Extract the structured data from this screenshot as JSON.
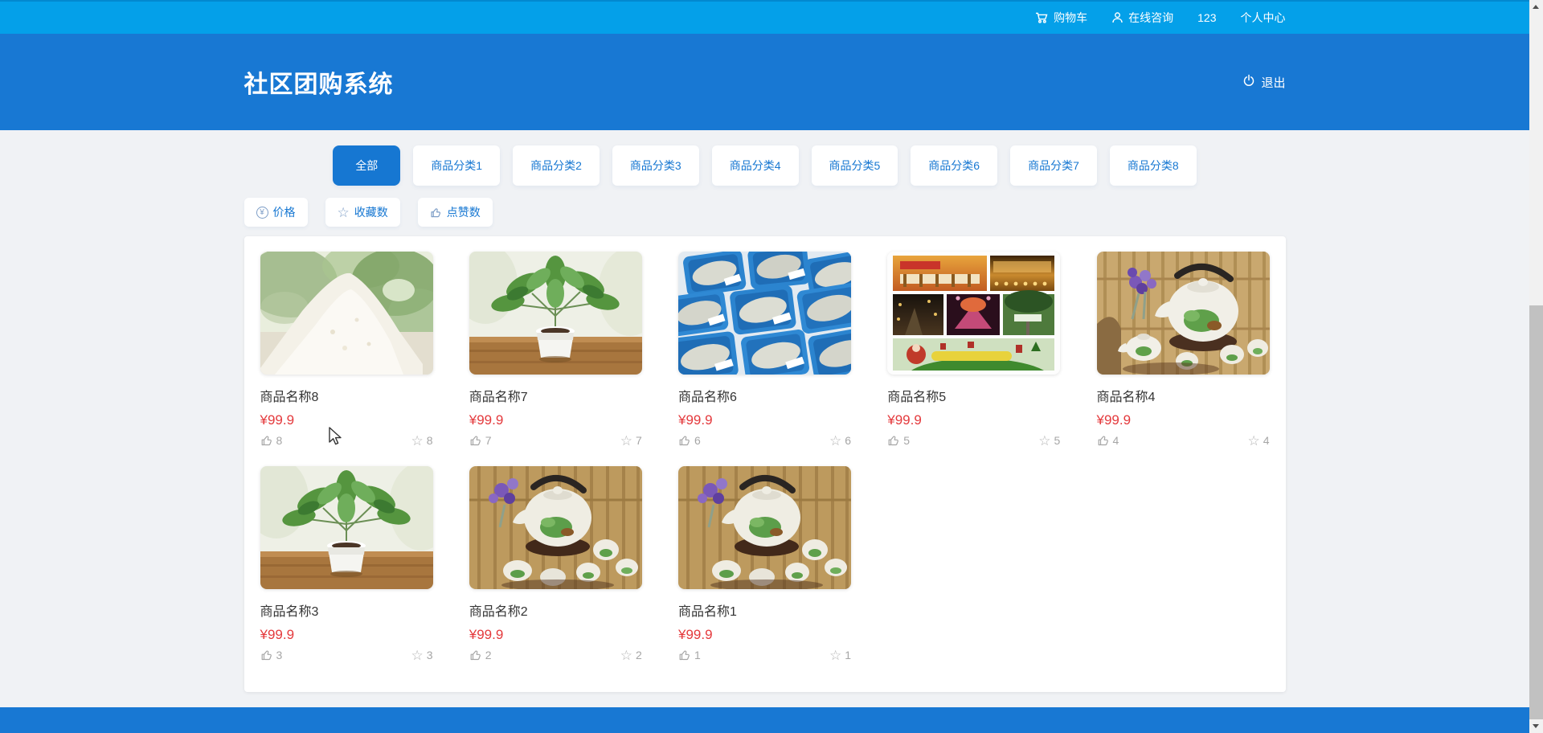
{
  "app": {
    "title": "社区团购系统"
  },
  "topbar": {
    "cart_label": "购物车",
    "consult_label": "在线咨询",
    "username": "123",
    "profile_label": "个人中心"
  },
  "header": {
    "logout_label": "退出"
  },
  "tabs": [
    {
      "label": "全部",
      "active": true
    },
    {
      "label": "商品分类1",
      "active": false
    },
    {
      "label": "商品分类2",
      "active": false
    },
    {
      "label": "商品分类3",
      "active": false
    },
    {
      "label": "商品分类4",
      "active": false
    },
    {
      "label": "商品分类5",
      "active": false
    },
    {
      "label": "商品分类6",
      "active": false
    },
    {
      "label": "商品分类7",
      "active": false
    },
    {
      "label": "商品分类8",
      "active": false
    }
  ],
  "sort_buttons": [
    {
      "label": "价格",
      "icon": "yen-circle-icon"
    },
    {
      "label": "收藏数",
      "icon": "star-icon"
    },
    {
      "label": "点赞数",
      "icon": "thumb-up-icon"
    }
  ],
  "products": [
    {
      "name": "商品名称8",
      "price": "¥99.9",
      "likes": "8",
      "favorites": "8",
      "image": "flour"
    },
    {
      "name": "商品名称7",
      "price": "¥99.9",
      "likes": "7",
      "favorites": "7",
      "image": "plant"
    },
    {
      "name": "商品名称6",
      "price": "¥99.9",
      "likes": "6",
      "favorites": "6",
      "image": "fish"
    },
    {
      "name": "商品名称5",
      "price": "¥99.9",
      "likes": "5",
      "favorites": "5",
      "image": "market"
    },
    {
      "name": "商品名称4",
      "price": "¥99.9",
      "likes": "4",
      "favorites": "4",
      "image": "teapot"
    },
    {
      "name": "商品名称3",
      "price": "¥99.9",
      "likes": "3",
      "favorites": "3",
      "image": "plant"
    },
    {
      "name": "商品名称2",
      "price": "¥99.9",
      "likes": "2",
      "favorites": "2",
      "image": "teapot2"
    },
    {
      "name": "商品名称1",
      "price": "¥99.9",
      "likes": "1",
      "favorites": "1",
      "image": "teapot2"
    }
  ],
  "colors": {
    "topbar_bg": "#04a0e9",
    "header_bg": "#1878d3",
    "footer_bg": "#1878d3",
    "accent_blue": "#1677d2",
    "price_red": "#e4393c",
    "page_bg": "#f0f2f5"
  }
}
